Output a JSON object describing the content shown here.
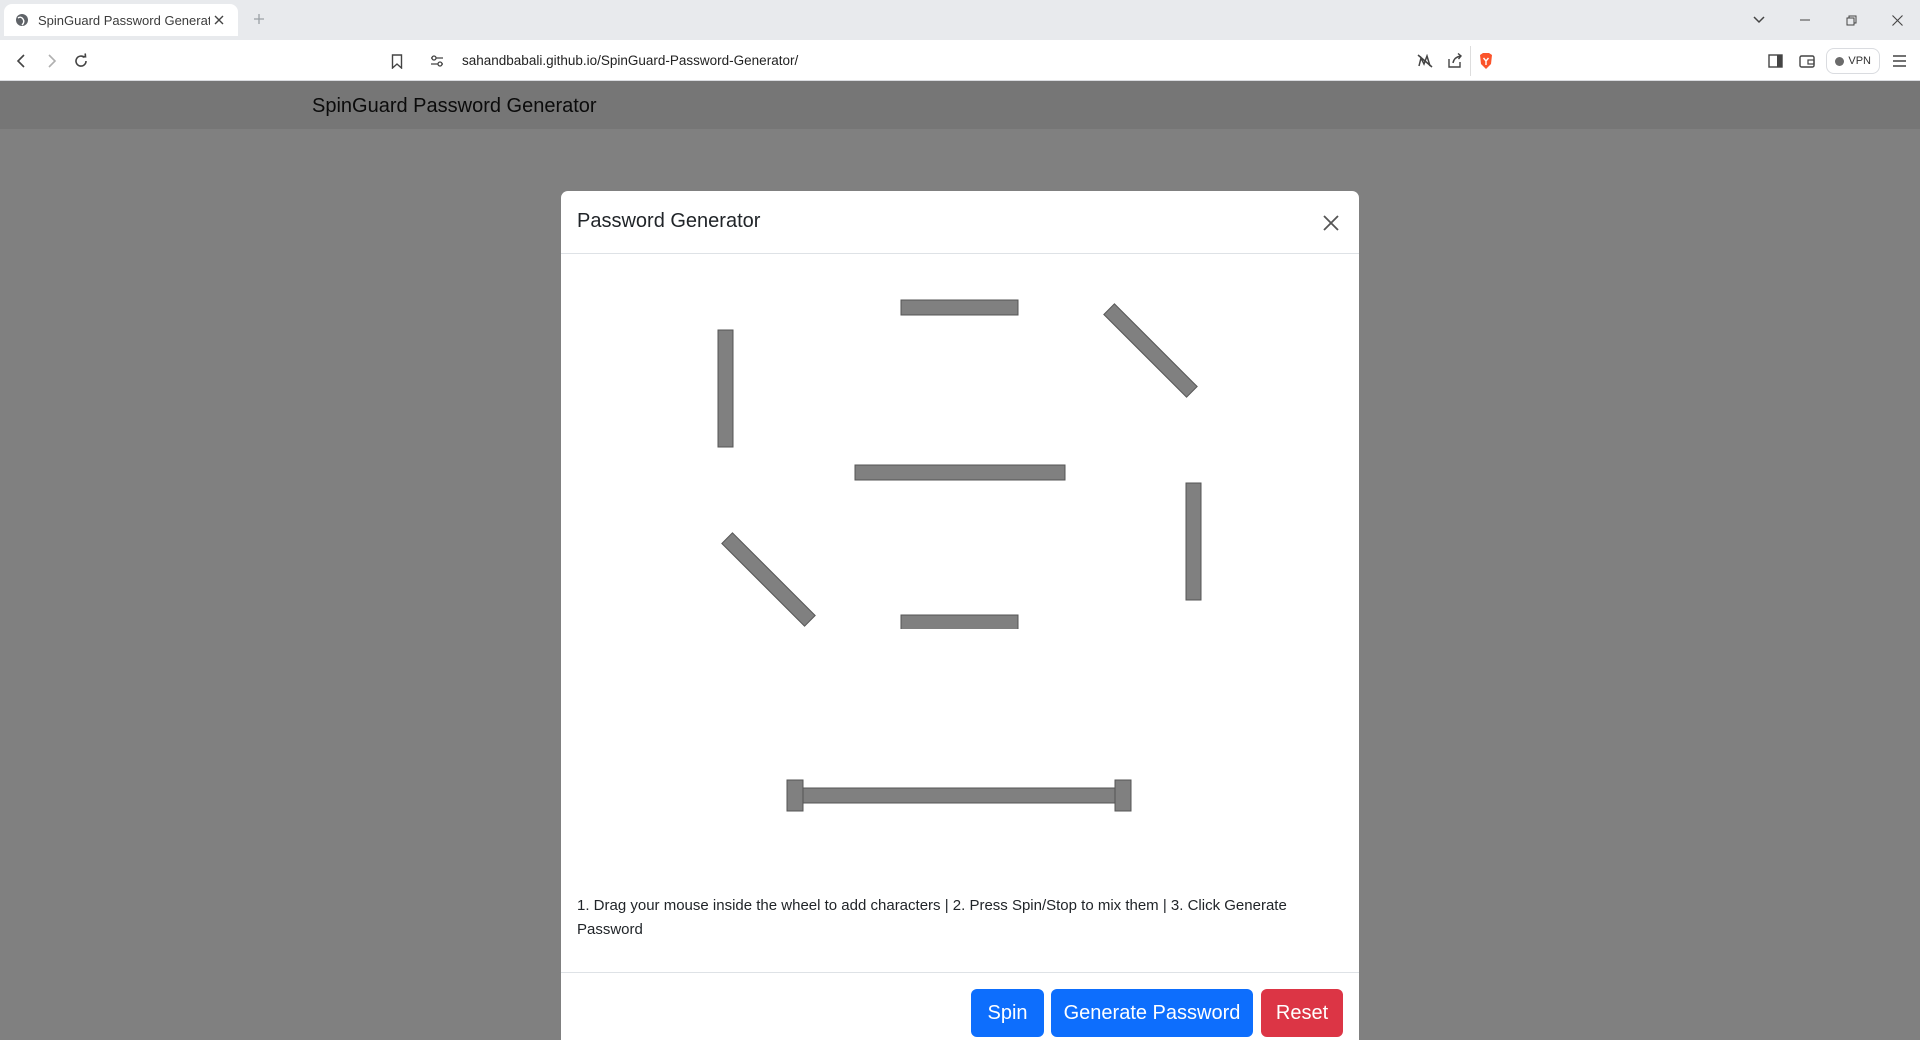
{
  "browser": {
    "tab_title": "SpinGuard Password Generator",
    "url": "sahandbabali.github.io/SpinGuard-Password-Generator/",
    "vpn_label": "VPN"
  },
  "page": {
    "title": "SpinGuard Password Generator"
  },
  "modal": {
    "title": "Password Generator",
    "instructions": "1. Drag your mouse inside the wheel to add characters | 2. Press Spin/Stop to mix them | 3. Click Generate Password",
    "buttons": {
      "spin": "Spin",
      "generate": "Generate Password",
      "reset": "Reset"
    }
  },
  "colors": {
    "primary": "#0d6efd",
    "danger": "#dc3545",
    "wheel_segment": "#808080"
  }
}
